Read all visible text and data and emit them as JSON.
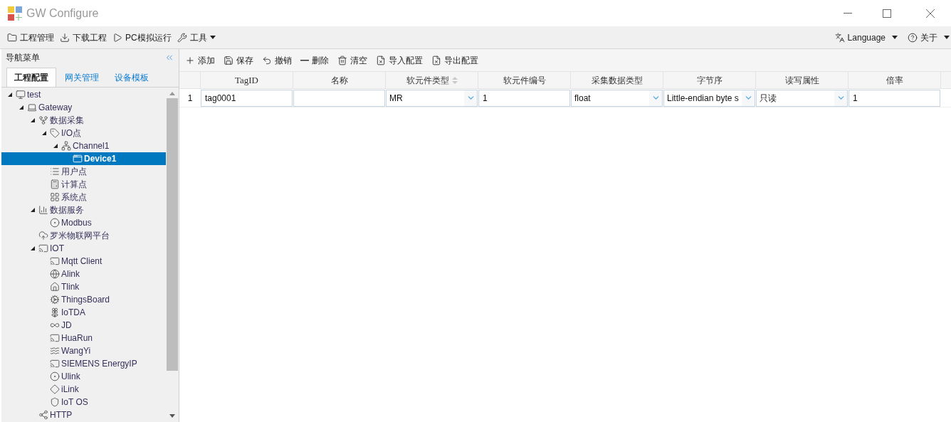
{
  "window": {
    "title": "GW Configure"
  },
  "menu": [
    {
      "label": "工程管理",
      "kind": "folder",
      "dropdown": false
    },
    {
      "label": "下载工程",
      "kind": "download",
      "dropdown": false
    },
    {
      "label": "PC模拟运行",
      "kind": "play",
      "dropdown": false
    },
    {
      "label": "工具",
      "kind": "wrench",
      "dropdown": true
    }
  ],
  "menu_right": [
    {
      "label": "Language",
      "kind": "language",
      "dropdown": true
    },
    {
      "label": "关于",
      "kind": "help",
      "dropdown": true
    }
  ],
  "nav": {
    "title": "导航菜单",
    "tabs": [
      {
        "label": "工程配置",
        "selected": true
      },
      {
        "label": "网关管理",
        "selected": false
      },
      {
        "label": "设备模板",
        "selected": false
      }
    ],
    "tree": [
      {
        "label": "test",
        "kind": "computer",
        "expanded": true,
        "selected": false,
        "children": [
          {
            "label": "Gateway",
            "kind": "laptop",
            "expanded": true,
            "selected": false,
            "children": [
              {
                "label": "数据采集",
                "kind": "fork",
                "expanded": true,
                "selected": false,
                "children": [
                  {
                    "label": "I/O点",
                    "kind": "tag",
                    "expanded": true,
                    "selected": false,
                    "children": [
                      {
                        "label": "Channel1",
                        "kind": "network",
                        "expanded": true,
                        "selected": false,
                        "children": [
                          {
                            "label": "Device1",
                            "kind": "window",
                            "selected": true
                          }
                        ]
                      }
                    ]
                  },
                  {
                    "label": "用户点",
                    "kind": "list",
                    "selected": false
                  },
                  {
                    "label": "计算点",
                    "kind": "calc",
                    "selected": false
                  },
                  {
                    "label": "系统点",
                    "kind": "grid",
                    "selected": false
                  }
                ]
              },
              {
                "label": "数据服务",
                "kind": "chart",
                "expanded": true,
                "selected": false,
                "children": [
                  {
                    "label": "Modbus",
                    "kind": "disc",
                    "selected": false
                  }
                ]
              },
              {
                "label": "罗米物联网平台",
                "kind": "cloud",
                "selected": false
              },
              {
                "label": "IOT",
                "kind": "cast",
                "expanded": true,
                "selected": false,
                "children": [
                  {
                    "label": "Mqtt Client",
                    "kind": "cast",
                    "selected": false
                  },
                  {
                    "label": "Alink",
                    "kind": "globe",
                    "selected": false
                  },
                  {
                    "label": "Tlink",
                    "kind": "home",
                    "selected": false
                  },
                  {
                    "label": "ThingsBoard",
                    "kind": "gear",
                    "selected": false
                  },
                  {
                    "label": "IoTDA",
                    "kind": "flower",
                    "selected": false
                  },
                  {
                    "label": "JD",
                    "kind": "infinity",
                    "selected": false
                  },
                  {
                    "label": "HuaRun",
                    "kind": "cast",
                    "selected": false
                  },
                  {
                    "label": "WangYi",
                    "kind": "swirl",
                    "selected": false
                  },
                  {
                    "label": "SIEMENS EnergyIP",
                    "kind": "cast",
                    "selected": false
                  },
                  {
                    "label": "Ulink",
                    "kind": "disc",
                    "selected": false
                  },
                  {
                    "label": "iLink",
                    "kind": "diamond",
                    "selected": false
                  },
                  {
                    "label": "IoT OS",
                    "kind": "shield",
                    "selected": false
                  }
                ]
              },
              {
                "label": "HTTP",
                "kind": "share",
                "selected": false
              }
            ]
          }
        ]
      }
    ]
  },
  "toolbar": [
    {
      "label": "添加",
      "kind": "plus"
    },
    {
      "label": "保存",
      "kind": "save"
    },
    {
      "label": "撤销",
      "kind": "undo"
    },
    {
      "label": "删除",
      "kind": "minus"
    },
    {
      "label": "清空",
      "kind": "trash"
    },
    {
      "label": "导入配置",
      "kind": "file"
    },
    {
      "label": "导出配置",
      "kind": "file"
    }
  ],
  "table": {
    "columns": [
      {
        "label": "TagID",
        "sortable": false
      },
      {
        "label": "名称",
        "sortable": false
      },
      {
        "label": "软元件类型",
        "sortable": true
      },
      {
        "label": "软元件编号",
        "sortable": false
      },
      {
        "label": "采集数据类型",
        "sortable": false
      },
      {
        "label": "字节序",
        "sortable": false
      },
      {
        "label": "读写属性",
        "sortable": false
      },
      {
        "label": "倍率",
        "sortable": false
      }
    ],
    "rows": [
      {
        "number": "1",
        "cells": [
          {
            "kind": "text",
            "value": "tag0001"
          },
          {
            "kind": "text"
          },
          {
            "kind": "select",
            "value": "MR"
          },
          {
            "kind": "text",
            "value": "1"
          },
          {
            "kind": "select",
            "value": "float"
          },
          {
            "kind": "select",
            "value": "Little-endian byte s"
          },
          {
            "kind": "select",
            "value": "只读"
          },
          {
            "kind": "text",
            "value": "1"
          }
        ]
      }
    ]
  }
}
